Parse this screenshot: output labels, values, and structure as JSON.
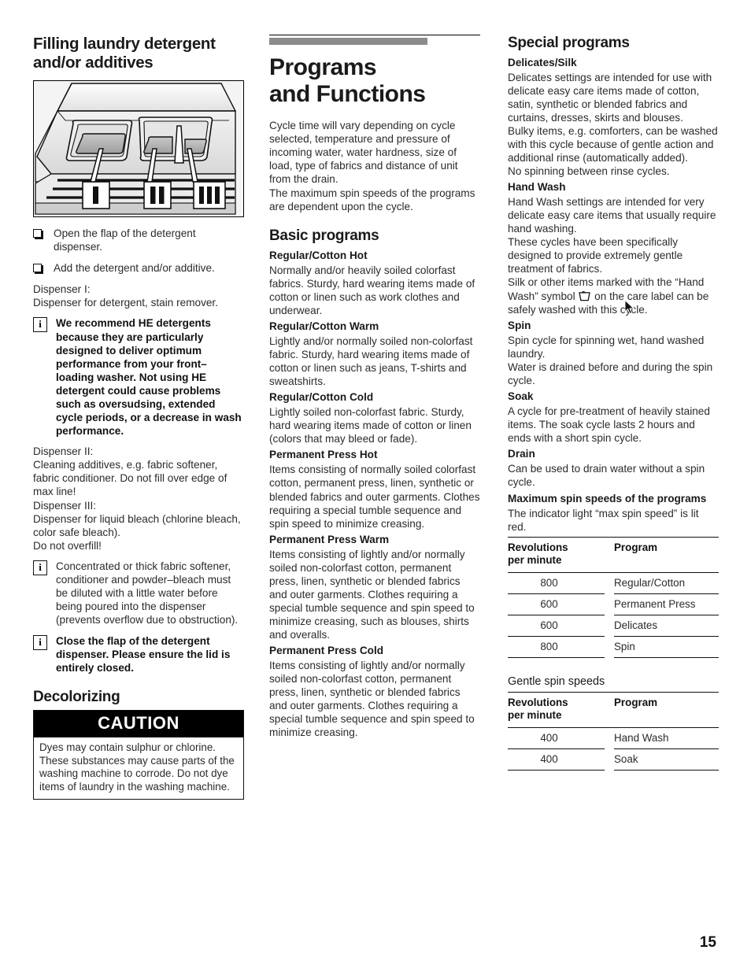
{
  "page_number": "15",
  "column_left": {
    "heading": "Filling laundry detergent and/or additives",
    "illustration_labels": [
      "I",
      "II",
      "III"
    ],
    "steps": [
      "Open the flap of the detergent dispenser.",
      "Add the detergent and/or additive."
    ],
    "dispenser_1_label": "Dispenser I:",
    "dispenser_1_text": "Dispenser for detergent, stain remover.",
    "note_1": "We recommend HE detergents because they are particularly designed to deliver optimum performance from your front–loading washer.  Not using HE detergent could cause problems such as oversudsing, extended cycle periods, or a decrease in wash performance.",
    "dispenser_2_label": "Dispenser II:",
    "dispenser_2_text": "Cleaning additives, e.g. fabric softener, fabric conditioner. Do not fill over edge of max line!",
    "dispenser_3_label": "Dispenser III:",
    "dispenser_3_text": "Dispenser for liquid bleach (chlorine bleach, color safe bleach).",
    "dispenser_3_text_2": "Do not overfill!",
    "note_2": "Concentrated or thick fabric softener, conditioner and powder–bleach must be diluted with a little water before being poured into the dispenser (prevents overflow due to obstruction).",
    "note_3": "Close the flap of the detergent dispenser.  Please ensure the lid is entirely closed.",
    "decolorizing_heading": "Decolorizing",
    "caution_title": "CAUTION",
    "caution_text": "Dyes may contain sulphur or chlorine. These substances may cause parts of the washing machine to corrode. Do not dye items of laundry in the washing machine."
  },
  "column_middle": {
    "chapter_title_line1": "Programs",
    "chapter_title_line2": "and Functions",
    "intro_1": "Cycle time will vary depending on cycle selected, temperature and pressure of incoming water, water hardness, size of load, type of fabrics and distance of unit from the drain.",
    "intro_2": "The maximum spin speeds of the programs are dependent upon the cycle.",
    "basic_programs_heading": "Basic programs",
    "programs": [
      {
        "title": "Regular/Cotton Hot",
        "text": "Normally and/or heavily soiled colorfast fabrics. Sturdy, hard wearing items made of cotton or linen such as work clothes and underwear."
      },
      {
        "title": "Regular/Cotton Warm",
        "text": "Lightly and/or normally soiled non-colorfast fabric. Sturdy, hard wearing items made of cotton or linen such as jeans, T-shirts and sweatshirts."
      },
      {
        "title": "Regular/Cotton Cold",
        "text": "Lightly soiled non-colorfast fabric. Sturdy, hard wearing items made of cotton or linen (colors that may bleed or fade)."
      },
      {
        "title": "Permanent Press Hot",
        "text": "Items consisting of normally soiled colorfast cotton, permanent press, linen, synthetic or blended fabrics and outer garments. Clothes requiring a special tumble sequence and spin speed to minimize creasing."
      },
      {
        "title": "Permanent Press Warm",
        "text": "Items consisting of lightly and/or normally soiled non-colorfast cotton, permanent press, linen, synthetic or blended fabrics and outer garments. Clothes requiring a special tumble sequence and spin speed to minimize creasing, such as blouses, shirts and overalls."
      },
      {
        "title": "Permanent Press Cold",
        "text": "Items consisting of lightly and/or normally soiled non-colorfast cotton, permanent press, linen, synthetic or blended fabrics and outer garments. Clothes requiring a special tumble sequence and spin speed to minimize creasing."
      }
    ]
  },
  "column_right": {
    "heading": "Special programs",
    "delicates_title": "Delicates/Silk",
    "delicates_text_1": "Delicates settings are intended for use with delicate easy care items made of cotton, satin, synthetic or blended fabrics and curtains, dresses, skirts and blouses.",
    "delicates_text_2": "Bulky items, e.g. comforters, can be washed with this cycle because of gentle action and additional rinse (automatically added).",
    "delicates_text_3": "No spinning between rinse cycles.",
    "handwash_title": "Hand Wash",
    "handwash_text_1": "Hand Wash settings are intended for very delicate easy care items that usually require hand washing.",
    "handwash_text_2": "These cycles have been specifically designed to provide extremely gentle treatment of fabrics.",
    "handwash_text_3a": "Silk or other items marked with the “Hand Wash” symbol",
    "handwash_text_3b": "on the care label can be safely washed with this cycle.",
    "spin_title": "Spin",
    "spin_text_1": "Spin cycle for spinning wet, hand washed laundry.",
    "spin_text_2": "Water is drained before and during the spin cycle.",
    "soak_title": "Soak",
    "soak_text": "A cycle for pre-treatment of heavily stained items. The soak cycle lasts 2 hours and ends with a short spin cycle.",
    "drain_title": "Drain",
    "drain_text": "Can be used to drain water without a spin cycle.",
    "max_spin_title": "Maximum spin speeds of the programs",
    "max_spin_note": "The indicator light “max spin speed” is lit red.",
    "max_spin_table": {
      "headers": [
        "Revolutions per minute",
        "Program"
      ],
      "header_rpm_line1": "Revolutions",
      "header_rpm_line2": "per minute",
      "rows": [
        {
          "rpm": "800",
          "program": "Regular/Cotton"
        },
        {
          "rpm": "600",
          "program": "Permanent Press"
        },
        {
          "rpm": "600",
          "program": "Delicates"
        },
        {
          "rpm": "800",
          "program": "Spin"
        }
      ]
    },
    "gentle_spin_caption": "Gentle spin speeds",
    "gentle_spin_table": {
      "header_rpm_line1": "Revolutions",
      "header_rpm_line2": "per minute",
      "header_program": "Program",
      "rows": [
        {
          "rpm": "400",
          "program": "Hand Wash"
        },
        {
          "rpm": "400",
          "program": "Soak"
        }
      ]
    }
  }
}
